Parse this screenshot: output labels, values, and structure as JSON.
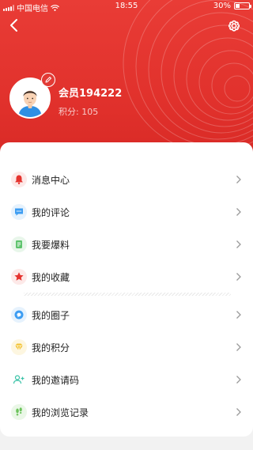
{
  "status_bar": {
    "carrier": "中国电信",
    "time": "18:55",
    "battery": "30%",
    "battery_level": 0.3
  },
  "profile": {
    "name": "会员194222",
    "points": "积分: 105"
  },
  "menu": {
    "group1": [
      {
        "label": "消息中心",
        "icon": "bell-icon",
        "color": "#e5332e"
      },
      {
        "label": "我的评论",
        "icon": "comment-icon",
        "color": "#3d9df2"
      },
      {
        "label": "我要爆料",
        "icon": "note-icon",
        "color": "#5cc36b"
      },
      {
        "label": "我的收藏",
        "icon": "star-icon",
        "color": "#e5332e"
      }
    ],
    "group2": [
      {
        "label": "我的圈子",
        "icon": "circle-chat-icon",
        "color": "#3d9df2"
      },
      {
        "label": "我的积分",
        "icon": "diamond-icon",
        "color": "#f2c12e"
      },
      {
        "label": "我的邀请码",
        "icon": "add-user-icon",
        "color": "#3cc3a8"
      },
      {
        "label": "我的浏览记录",
        "icon": "footprint-icon",
        "color": "#6cc35b"
      }
    ]
  },
  "colors": {
    "accent": "#e23a35",
    "text": "#222222",
    "chevron": "#9a9a9a"
  }
}
